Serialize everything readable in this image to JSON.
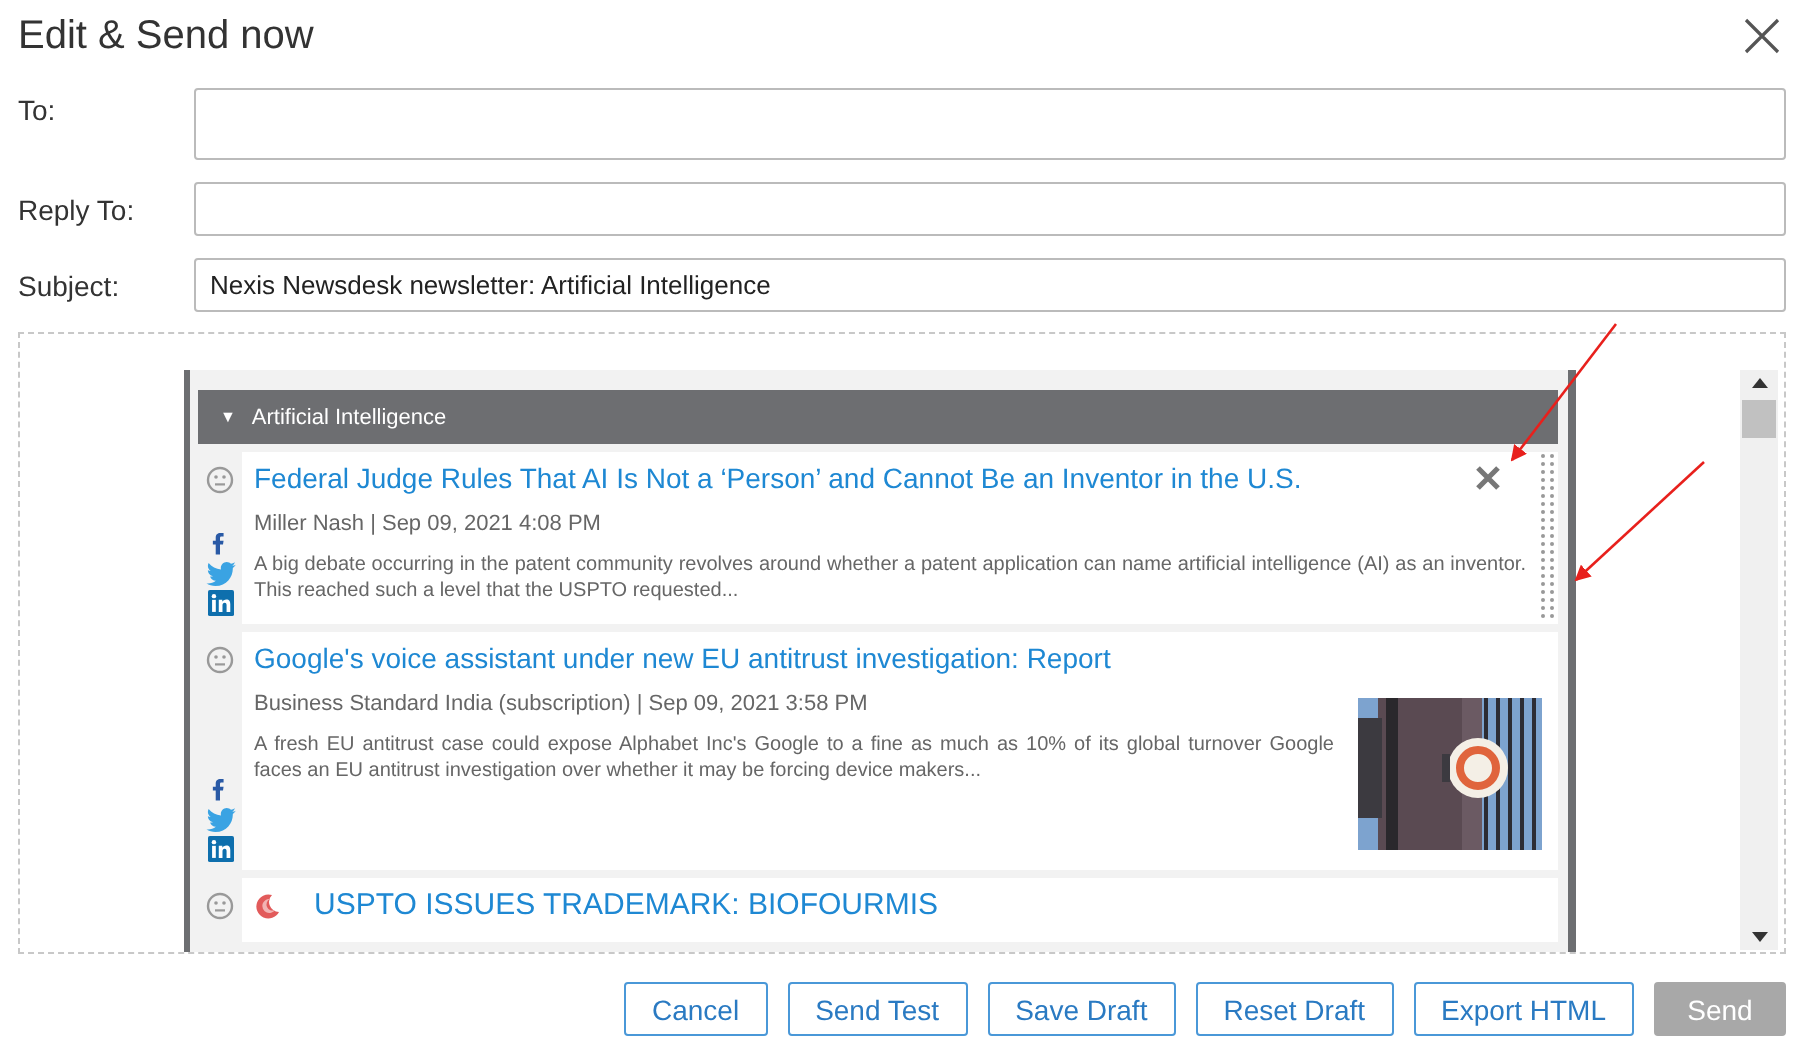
{
  "dialog": {
    "title": "Edit & Send now"
  },
  "fields": [
    {
      "label": "To:",
      "kind": "tall"
    },
    {
      "label": "Reply To:",
      "kind": "line"
    },
    {
      "label": "Subject:",
      "kind": "line",
      "value": "Nexis Newsdesk newsletter: Artificial Intelligence"
    }
  ],
  "section": {
    "toggle": "▼",
    "title": "Artificial Intelligence"
  },
  "articles": [
    {
      "title": "Federal Judge Rules That AI Is Not a ‘Person’ and Cannot Be an Inventor in the U.S.",
      "meta": "Miller Nash | Sep 09, 2021 4:08 PM",
      "summary": "A big debate occurring in the patent community revolves around whether a patent application can name artificial intelligence (AI) as an inventor. This reached such a level that the USPTO requested...",
      "social": true,
      "image": false,
      "source_logo": false,
      "controls": true
    },
    {
      "title": "Google's voice assistant under new EU antitrust investigation: Report",
      "meta": "Business Standard India (subscription) | Sep 09, 2021 3:58 PM",
      "summary": "A fresh EU antitrust case could expose Alphabet Inc's Google to a fine as much as 10% of its global turnover Google faces an EU antitrust investigation over whether it may be forcing device makers...",
      "social": true,
      "image": true,
      "source_logo": false,
      "controls": false
    },
    {
      "title": "USPTO ISSUES TRADEMARK: BIOFOURMIS",
      "social": false,
      "image": false,
      "source_logo": true,
      "controls": false
    }
  ],
  "buttons": [
    {
      "label": "Cancel",
      "disabled": false
    },
    {
      "label": "Send Test",
      "disabled": false
    },
    {
      "label": "Save Draft",
      "disabled": false
    },
    {
      "label": "Reset Draft",
      "disabled": false
    },
    {
      "label": "Export HTML",
      "disabled": false
    },
    {
      "label": "Send",
      "disabled": true
    }
  ]
}
